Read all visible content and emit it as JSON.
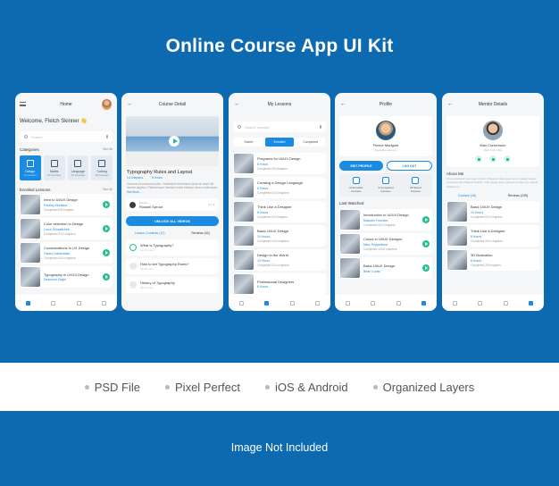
{
  "colors": {
    "background": "#0d6ab0",
    "accent": "#1a8be0",
    "success": "#26c28a"
  },
  "title": "Online Course App UI Kit",
  "screens": {
    "home": {
      "header_title": "Home",
      "welcome": "Welcome, Fletch Skinner 👋",
      "search_placeholder": "Search",
      "categories_title": "Categories",
      "see_all": "See All",
      "categories": [
        {
          "name": "Design",
          "count": "6 Courses",
          "icon": "design-icon"
        },
        {
          "name": "Maths",
          "count": "10 Courses",
          "icon": "maths-icon"
        },
        {
          "name": "Language",
          "count": "12 Courses",
          "icon": "language-icon"
        },
        {
          "name": "Coding",
          "count": "16 Courses",
          "icon": "code-icon"
        }
      ],
      "enrolled_title": "Enrolled Lessons",
      "lessons": [
        {
          "title": "Intro to UI/UX Design",
          "author": "Parsley Montana",
          "progress": "Completed 6/8 chapters"
        },
        {
          "title": "Color selection in Design",
          "author": "Lurch Schpellchek",
          "progress": "Completed 2/12 chapters"
        },
        {
          "title": "Considerations in UX Design",
          "author": "Gizmo Hollandaise",
          "progress": "Completed 4/14 chapters"
        },
        {
          "title": "Typography in UX/UI Design",
          "author": "Desmond Eagle",
          "progress": ""
        }
      ]
    },
    "course_detail": {
      "header_title": "Course Detail",
      "course_title": "Typography Rules and Layout",
      "chapters": "14 chapters",
      "hours": "6 hours",
      "description": "Vivamus et commodo justo. Vestibulum fermentum lacus sit amet elit laoreet dapibus. Pellentesque habitant morbi tristique senec malesuada.",
      "see_more": "See More...",
      "mentor_label": "Mentor",
      "mentor_name": "Russell Sprout",
      "rating": "4.9",
      "unlock_button": "UNLOCK ALL VIDEOS",
      "tab_contents": "Lesson Contents (12)",
      "tab_reviews": "Reviews (42)",
      "chapters_list": [
        {
          "title": "What is Typography?",
          "duration": "12:34 mins"
        },
        {
          "title": "How to set Typography Rules?",
          "duration": "23:45 mins"
        },
        {
          "title": "History of Typography",
          "duration": "18:24 mins"
        }
      ]
    },
    "my_lessons": {
      "header_title": "My Lessons",
      "search_placeholder": "Search lessons",
      "segments": [
        "Saved",
        "Enrolled",
        "Completed"
      ],
      "active_segment": "Enrolled",
      "lessons": [
        {
          "title": "Programs for UI/UX Design",
          "hours": "8 Hours",
          "progress": "Completed 2/8 chapters"
        },
        {
          "title": "Creating a Design Language",
          "hours": "8 Hours",
          "progress": "Completed 4/10 chapters"
        },
        {
          "title": "Think Like a Designer",
          "hours": "8 Hours",
          "progress": "Completed 0/3 chapters"
        },
        {
          "title": "Basic UI/UX Design",
          "hours": "10 Hours",
          "progress": "Completed 2/10 chapters"
        },
        {
          "title": "Design in the World",
          "hours": "10 Hours",
          "progress": "Completed 0/14 chapters"
        },
        {
          "title": "Professional Designers",
          "hours": "8 Hours",
          "progress": ""
        }
      ]
    },
    "profile": {
      "header_title": "Profile",
      "name": "Fleece Marigold",
      "email": "fleece@email.com",
      "edit_button": "EDIT PROFILE",
      "logout_button": "LOG OUT",
      "stats": [
        {
          "label": "12 Enrolled",
          "sub": "Courses"
        },
        {
          "label": "9 Completed",
          "sub": "Courses"
        },
        {
          "label": "28 Saved",
          "sub": "Courses"
        }
      ],
      "last_watched_title": "Last Watched",
      "lessons": [
        {
          "title": "Introduction to UI/UX Design",
          "author": "Malcolm Function",
          "progress": "Completed 5/12 chapters"
        },
        {
          "title": "Colors in UI/UX Designs",
          "author": "Niles Peppertrout",
          "progress": "Completed 10/16 chapters"
        },
        {
          "title": "Basic UI/UX Design",
          "author": "Brian Cumin",
          "progress": ""
        }
      ]
    },
    "mentor": {
      "header_title": "Mentor Details",
      "name": "Max Conversion",
      "location": "New York, USA",
      "about_title": "About Me",
      "about": "Cras gravida id risus eget cursus. Praesent vitae quam eros. Integer tempor venenatis nisl tristique facilisis. Cras neque ante, interdum in diam eu, blandit tristique ex.",
      "tab_courses": "Courses (16)",
      "tab_reviews": "Reviews (245)",
      "lessons": [
        {
          "title": "Basic UI/UX Design",
          "hours": "10 Hours",
          "progress": "Completed 8/10 chapters"
        },
        {
          "title": "Think Like a Designer",
          "hours": "8 Hours",
          "progress": "Completed 4/10 chapters"
        },
        {
          "title": "3D Illustration",
          "hours": "8 Hours",
          "progress": "Completed 2/8 chapters"
        }
      ]
    }
  },
  "features": [
    "PSD File",
    "Pixel Perfect",
    "iOS & Android",
    "Organized Layers"
  ],
  "footer": "Image Not Included"
}
